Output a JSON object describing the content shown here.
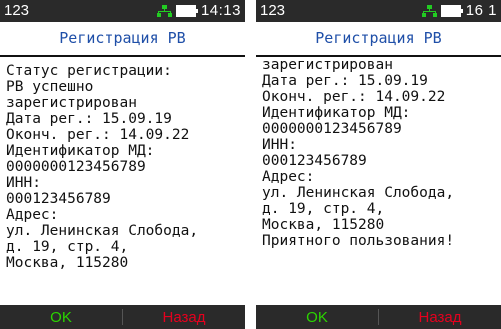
{
  "screens": [
    {
      "status": {
        "signal": "123",
        "time": "14:13"
      },
      "title": "Регистрация РВ",
      "lines": [
        "Статус регистрации:",
        "РВ успешно",
        "зарегистрирован",
        "Дата рег.: 15.09.19",
        "Оконч. рег.: 14.09.22",
        "Идентификатор МД:",
        "0000000123456789",
        "ИНН:",
        "000123456789",
        "Адрес:",
        "ул. Ленинская Слобода,",
        " д. 19, стр. 4,",
        "Москва, 115280"
      ],
      "softkeys": {
        "ok": "OK",
        "back": "Назад"
      }
    },
    {
      "status": {
        "signal": "123",
        "time": "16 1"
      },
      "title": "Регистрация РВ",
      "lines": [
        "зарегистрирован",
        "Дата рег.: 15.09.19",
        "Оконч. рег.: 14.09.22",
        "Идентификатор МД:",
        "0000000123456789",
        "ИНН:",
        "000123456789",
        "Адрес:",
        "ул. Ленинская Слобода,",
        " д. 19, стр. 4,",
        "Москва, 115280",
        "Приятного пользования!"
      ],
      "softkeys": {
        "ok": "OK",
        "back": "Назад"
      }
    }
  ],
  "colors": {
    "title": "#1f4fa8",
    "bar": "#2a2a2a",
    "ok": "#2bd400",
    "back": "#e6001e",
    "network_icon": "#22cc22"
  },
  "icons": [
    "network-icon",
    "battery-icon"
  ]
}
